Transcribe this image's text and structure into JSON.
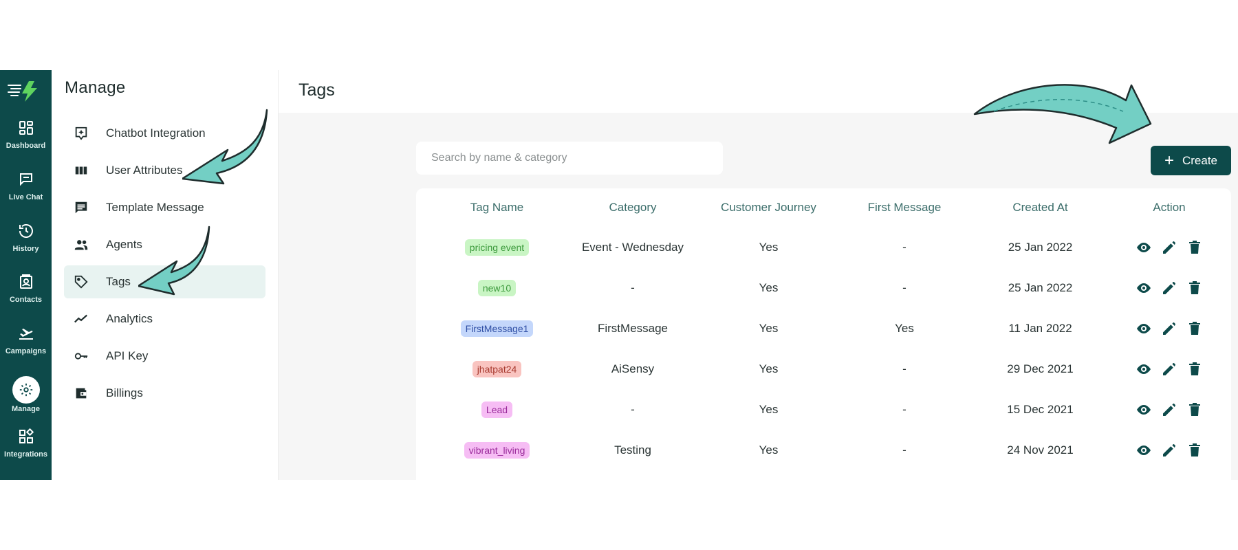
{
  "rail": {
    "items": [
      {
        "label": "Dashboard",
        "icon": "dashboard-icon"
      },
      {
        "label": "Live Chat",
        "icon": "chat-icon"
      },
      {
        "label": "History",
        "icon": "history-icon"
      },
      {
        "label": "Contacts",
        "icon": "contacts-icon"
      },
      {
        "label": "Campaigns",
        "icon": "campaigns-icon"
      },
      {
        "label": "Manage",
        "icon": "gear-icon",
        "active": true
      },
      {
        "label": "Integrations",
        "icon": "integrations-icon"
      }
    ]
  },
  "manage": {
    "title": "Manage",
    "items": [
      {
        "label": "Chatbot Integration",
        "icon": "chatbot-icon"
      },
      {
        "label": "User Attributes",
        "icon": "columns-icon"
      },
      {
        "label": "Template Message",
        "icon": "message-icon"
      },
      {
        "label": "Agents",
        "icon": "people-icon"
      },
      {
        "label": "Tags",
        "icon": "tag-icon",
        "active": true
      },
      {
        "label": "Analytics",
        "icon": "trend-icon"
      },
      {
        "label": "API Key",
        "icon": "key-icon"
      },
      {
        "label": "Billings",
        "icon": "wallet-icon"
      }
    ]
  },
  "main": {
    "title": "Tags",
    "search_placeholder": "Search by name & category",
    "create_label": "Create"
  },
  "table": {
    "headers": [
      "Tag Name",
      "Category",
      "Customer Journey",
      "First Message",
      "Created At",
      "Action"
    ],
    "rows": [
      {
        "tag": "pricing event",
        "category": "Event - Wednesday",
        "journey": "Yes",
        "first_message": "-",
        "created": "25 Jan 2022"
      },
      {
        "tag": "new10",
        "category": "-",
        "journey": "Yes",
        "first_message": "-",
        "created": "25 Jan 2022"
      },
      {
        "tag": "FirstMessage1",
        "category": "FirstMessage",
        "journey": "Yes",
        "first_message": "Yes",
        "created": "11 Jan 2022"
      },
      {
        "tag": "jhatpat24",
        "category": "AiSensy",
        "journey": "Yes",
        "first_message": "-",
        "created": "29 Dec 2021"
      },
      {
        "tag": "Lead",
        "category": "-",
        "journey": "Yes",
        "first_message": "-",
        "created": "15 Dec 2021"
      },
      {
        "tag": "vibrant_living",
        "category": "Testing",
        "journey": "Yes",
        "first_message": "-",
        "created": "24 Nov 2021"
      }
    ]
  },
  "colors": {
    "brand": "#0d4a4a",
    "accent": "#73cfc4",
    "tag_colors": [
      {
        "bg": "#c9f5c4",
        "fg": "#3c9a3c"
      },
      {
        "bg": "#c9f5c4",
        "fg": "#3c9a3c"
      },
      {
        "bg": "#c4d7fb",
        "fg": "#2f4fa5"
      },
      {
        "bg": "#f9c4c0",
        "fg": "#a83a2f"
      },
      {
        "bg": "#f6bdf4",
        "fg": "#9a2a9a"
      },
      {
        "bg": "#f6bdf4",
        "fg": "#9a2a9a"
      }
    ]
  }
}
